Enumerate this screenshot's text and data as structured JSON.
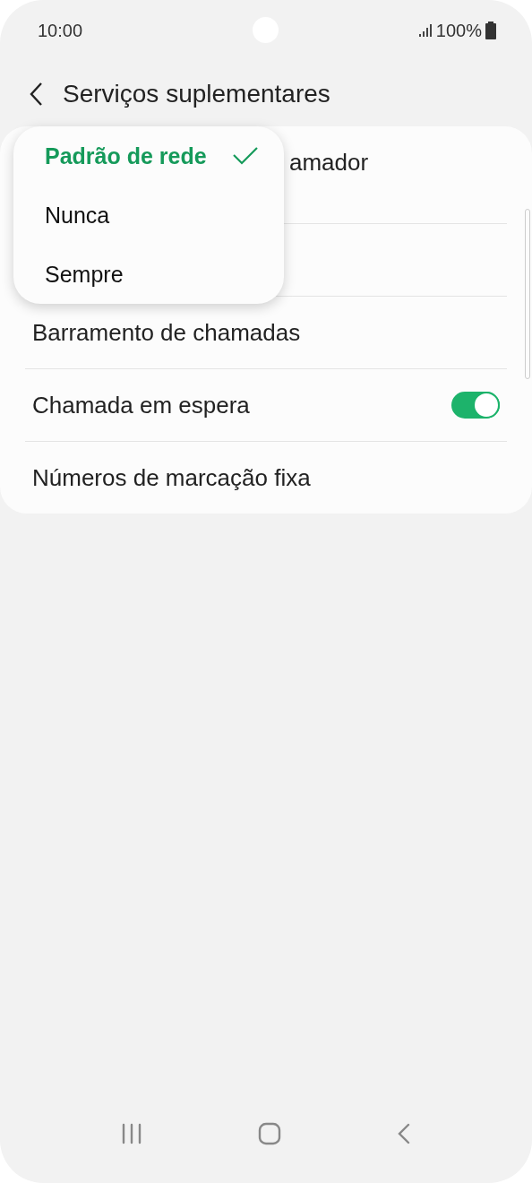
{
  "status_bar": {
    "time": "10:00",
    "battery": "100%"
  },
  "header": {
    "title": "Serviços suplementares"
  },
  "settings": [
    {
      "kind": "partial",
      "label": "amador"
    },
    {
      "kind": "hidden"
    },
    {
      "kind": "plain",
      "label": "Barramento de chamadas"
    },
    {
      "kind": "switch",
      "label": "Chamada em espera",
      "on": true
    },
    {
      "kind": "plain",
      "label": "Números de marcação fixa"
    }
  ],
  "menu": {
    "options": [
      {
        "label": "Padrão de rede",
        "selected": true
      },
      {
        "label": "Nunca",
        "selected": false
      },
      {
        "label": "Sempre",
        "selected": false
      }
    ]
  }
}
